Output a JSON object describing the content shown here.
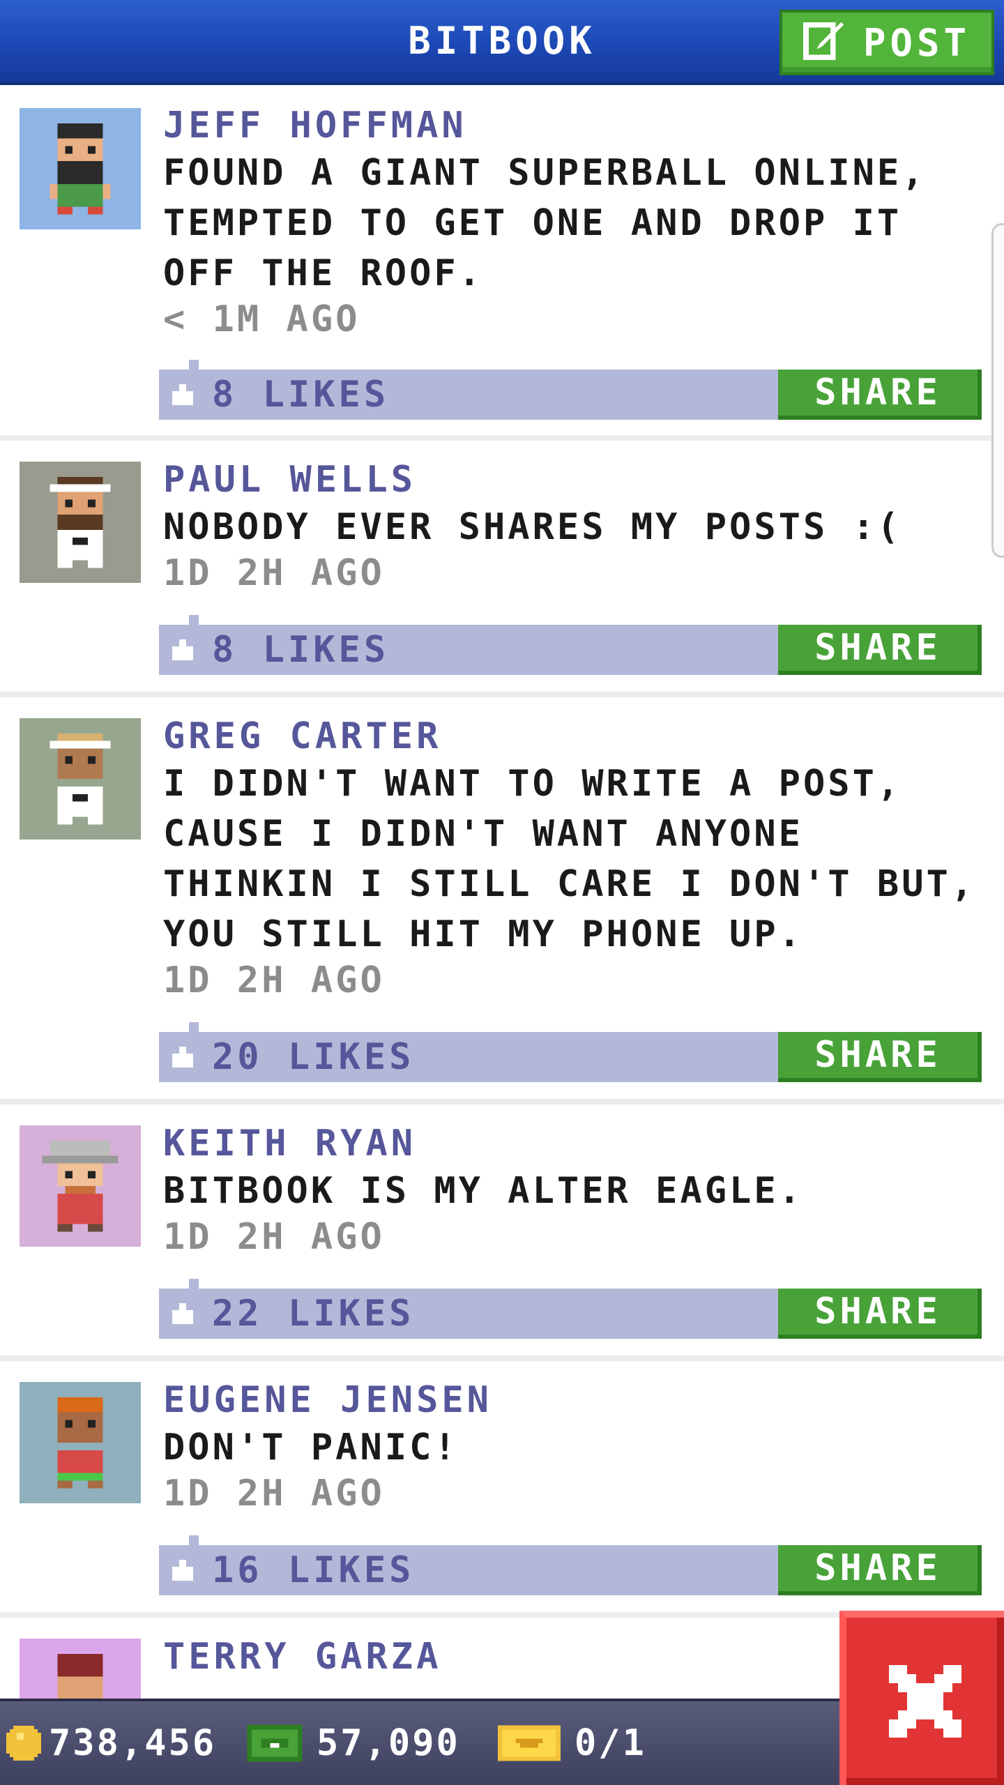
{
  "header": {
    "title": "BITBOOK",
    "post_label": "POST"
  },
  "posts": [
    {
      "author": "JEFF HOFFMAN",
      "text": "FOUND A GIANT SUPERBALL ONLINE, TEMPTED TO GET ONE AND DROP IT OFF THE ROOF.",
      "time": "< 1M AGO",
      "likes": "8 LIKES",
      "share": "SHARE",
      "avatar_bg": "#8fb4e6"
    },
    {
      "author": "PAUL WELLS",
      "text": "NOBODY EVER SHARES MY POSTS :(",
      "time": "1D 2H AGO",
      "likes": "8 LIKES",
      "share": "SHARE",
      "avatar_bg": "#9a9a8e"
    },
    {
      "author": "GREG CARTER",
      "text": "I DIDN'T WANT TO WRITE A POST, CAUSE I DIDN'T WANT ANYONE THINKIN I STILL CARE I DON'T BUT, YOU STILL HIT MY PHONE UP.",
      "time": "1D 2H AGO",
      "likes": "20 LIKES",
      "share": "SHARE",
      "avatar_bg": "#97a68e"
    },
    {
      "author": "KEITH RYAN",
      "text": "BITBOOK IS MY ALTER EAGLE.",
      "time": "1D 2H AGO",
      "likes": "22 LIKES",
      "share": "SHARE",
      "avatar_bg": "#d6b0d8"
    },
    {
      "author": "EUGENE JENSEN",
      "text": "DON'T PANIC!",
      "time": "1D 2H AGO",
      "likes": "16 LIKES",
      "share": "SHARE",
      "avatar_bg": "#8fb0bc"
    },
    {
      "author": "TERRY GARZA",
      "avatar_bg": "#dca6ec"
    }
  ],
  "bottom_bar": {
    "coins": "738,456",
    "bux": "57,090",
    "tickets": "0/1"
  },
  "colors": {
    "header": "#1c48b4",
    "share": "#48a238",
    "like_bar": "#b4b8d8",
    "author": "#56569a",
    "close": "#e23434"
  },
  "icons": {
    "post": "edit-icon",
    "like": "thumbs-up-icon",
    "coin": "coin-icon",
    "bux": "bux-icon",
    "ticket": "ticket-icon",
    "close": "close-icon"
  }
}
